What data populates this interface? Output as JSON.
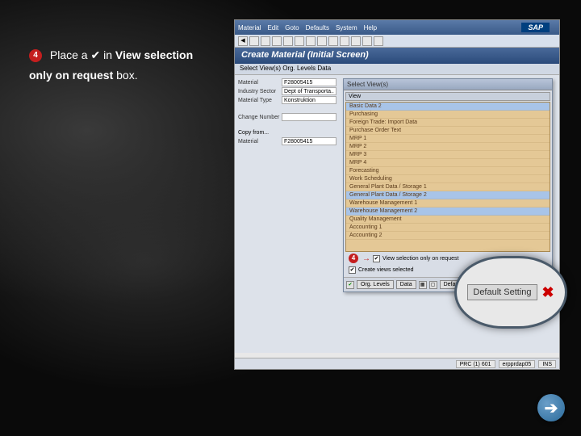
{
  "instruction": {
    "step": "4",
    "text_before": "Place a ",
    "check": "✔",
    "text_mid": " in ",
    "bold1": "View selection",
    "bold2": "only on request",
    "text_after": " box."
  },
  "sap": {
    "menu": {
      "m1": "Material",
      "m2": "Edit",
      "m3": "Goto",
      "m4": "Defaults",
      "m5": "System",
      "m6": "Help"
    },
    "logo": "SAP",
    "header": "Create Material (Initial Screen)",
    "subheader": "Select View(s)   Org. Levels   Data",
    "form": {
      "material_lbl": "Material",
      "material_val": "F28005415",
      "sector_lbl": "Industry Sector",
      "sector_val": "Dept of Transporta..",
      "type_lbl": "Material Type",
      "type_val": "Konstruktion produ..",
      "change_lbl": "Change Number",
      "copy_lbl": "Copy from...",
      "copy_mat_lbl": "Material",
      "copy_mat_val": "F28005415"
    },
    "dialog": {
      "title": "Select View(s)",
      "view_header": "View",
      "items": [
        "Basic Data 2",
        "Purchasing",
        "Foreign Trade: Import Data",
        "Purchase Order Text",
        "MRP 1",
        "MRP 2",
        "MRP 3",
        "MRP 4",
        "Forecasting",
        "Work Scheduling",
        "General Plant Data / Storage 1",
        "General Plant Data / Storage 2",
        "Warehouse Management 1",
        "Warehouse Management 2",
        "Quality Management",
        "Accounting 1",
        "Accounting 2"
      ],
      "cb1_label": "View selection only on request",
      "cb2_label": "Create views selected",
      "step_badge": "4",
      "footer": {
        "org": "Org. Levels",
        "data": "Data",
        "default": "Default Settings"
      }
    },
    "magnifier": {
      "label": "Default Setting"
    },
    "status": {
      "s1": "PRC (1) 601",
      "s2": "erpprdap05",
      "s3": "INS"
    }
  },
  "check_icon": "✔",
  "x_icon": "✖",
  "arrow_icon": "➔"
}
